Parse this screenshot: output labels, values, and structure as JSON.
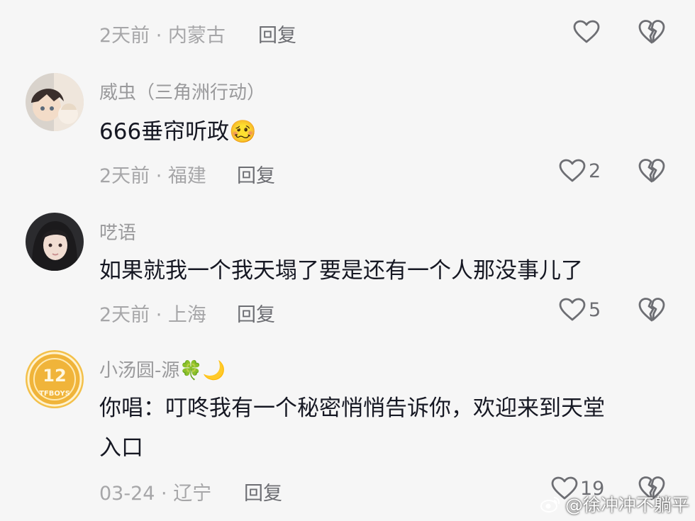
{
  "comments": [
    {
      "time": "2天前 · 内蒙古",
      "reply": "回复",
      "likes": ""
    },
    {
      "username": "威虫（三角洲行动）",
      "text": "666垂帘听政",
      "emoji": "🥴",
      "time": "2天前 · 福建",
      "reply": "回复",
      "likes": "2"
    },
    {
      "username": "呓语",
      "text": "如果就我一个我天塌了要是还有一个人那没事儿了",
      "time": "2天前 · 上海",
      "reply": "回复",
      "likes": "5"
    },
    {
      "username": "小汤圆-源",
      "username_emoji": "🍀🌙",
      "text_line1": "你唱：叮咚我有一个秘密悄悄告诉你，欢迎来到天堂",
      "text_line2": "入口",
      "time": "03-24 · 辽宁",
      "reply": "回复",
      "likes": "19",
      "avatar_badge_text": "12",
      "avatar_badge_sub": "TFBOYS"
    }
  ],
  "watermark": {
    "platform_icon": "weibo-icon",
    "text": "@徐冲冲不躺平"
  },
  "icons": {
    "like": "heart-outline-icon",
    "dislike": "broken-heart-icon"
  },
  "colors": {
    "background": "#f6f6f6",
    "meta_gray": "#a6a6a8",
    "text_dark": "#161823"
  }
}
